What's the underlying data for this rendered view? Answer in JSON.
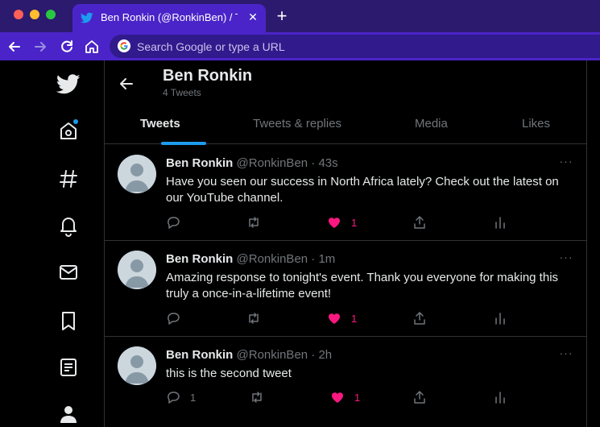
{
  "browser": {
    "tab_title": "Ben Ronkin (@RonkinBen) / Tw",
    "tab_close": "✕",
    "new_tab": "+",
    "omnibox_placeholder": "Search Google or type a URL"
  },
  "profile": {
    "name": "Ben Ronkin",
    "tweet_count": "4 Tweets"
  },
  "profile_tabs": [
    {
      "label": "Tweets",
      "active": true
    },
    {
      "label": "Tweets & replies",
      "active": false
    },
    {
      "label": "Media",
      "active": false
    },
    {
      "label": "Likes",
      "active": false
    }
  ],
  "tweets": [
    {
      "name": "Ben Ronkin",
      "meta": "@RonkinBen · 43s",
      "text": "Have you seen our success in North Africa lately? Check out the latest on our YouTube channel.",
      "reply_count": "",
      "like_count": "1",
      "liked": true
    },
    {
      "name": "Ben Ronkin",
      "meta": "@RonkinBen · 1m",
      "text": "Amazing response to tonight's event. Thank you everyone for making this truly a once-in-a-lifetime event!",
      "reply_count": "",
      "like_count": "1",
      "liked": true
    },
    {
      "name": "Ben Ronkin",
      "meta": "@RonkinBen · 2h",
      "text": "this is the second tweet",
      "reply_count": "1",
      "like_count": "1",
      "liked": true
    }
  ],
  "more_glyph": "···",
  "colors": {
    "accent": "#1d9bf0",
    "like": "#f91880",
    "browser_tab": "#4a24c8",
    "browser_frame": "#2b1a6e"
  },
  "icons": [
    "twitter-logo-icon",
    "home-icon",
    "explore-hash-icon",
    "notifications-bell-icon",
    "messages-mail-icon",
    "bookmarks-icon",
    "lists-icon",
    "profile-icon",
    "reply-icon",
    "retweet-icon",
    "like-heart-icon",
    "share-icon",
    "analytics-icon"
  ]
}
